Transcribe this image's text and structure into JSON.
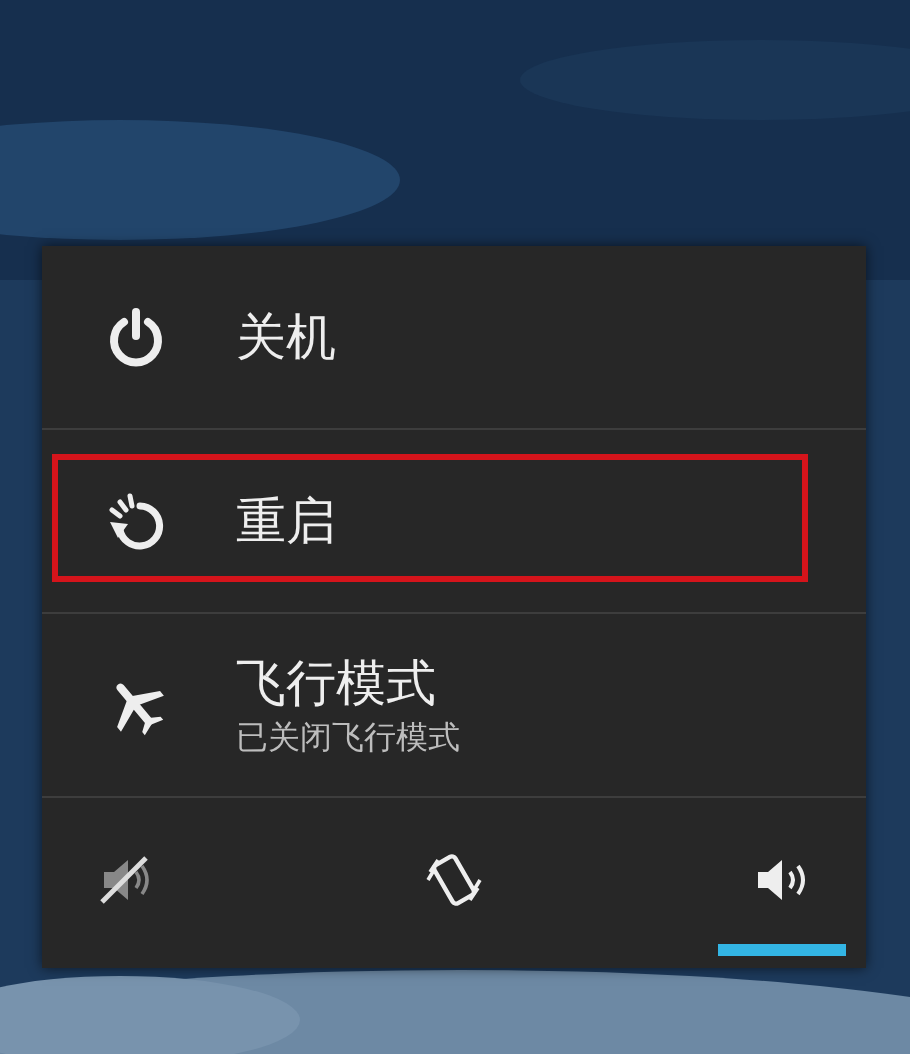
{
  "power_menu": {
    "items": [
      {
        "kind": "power",
        "label": "关机",
        "highlighted": false
      },
      {
        "kind": "reboot",
        "label": "重启",
        "highlighted": true
      },
      {
        "kind": "airplane",
        "label": "飞行模式",
        "status": "已关闭飞行模式",
        "highlighted": false
      }
    ],
    "sound_modes": [
      {
        "kind": "silent",
        "selected": false
      },
      {
        "kind": "vibrate",
        "selected": false
      },
      {
        "kind": "sound",
        "selected": true
      }
    ]
  }
}
